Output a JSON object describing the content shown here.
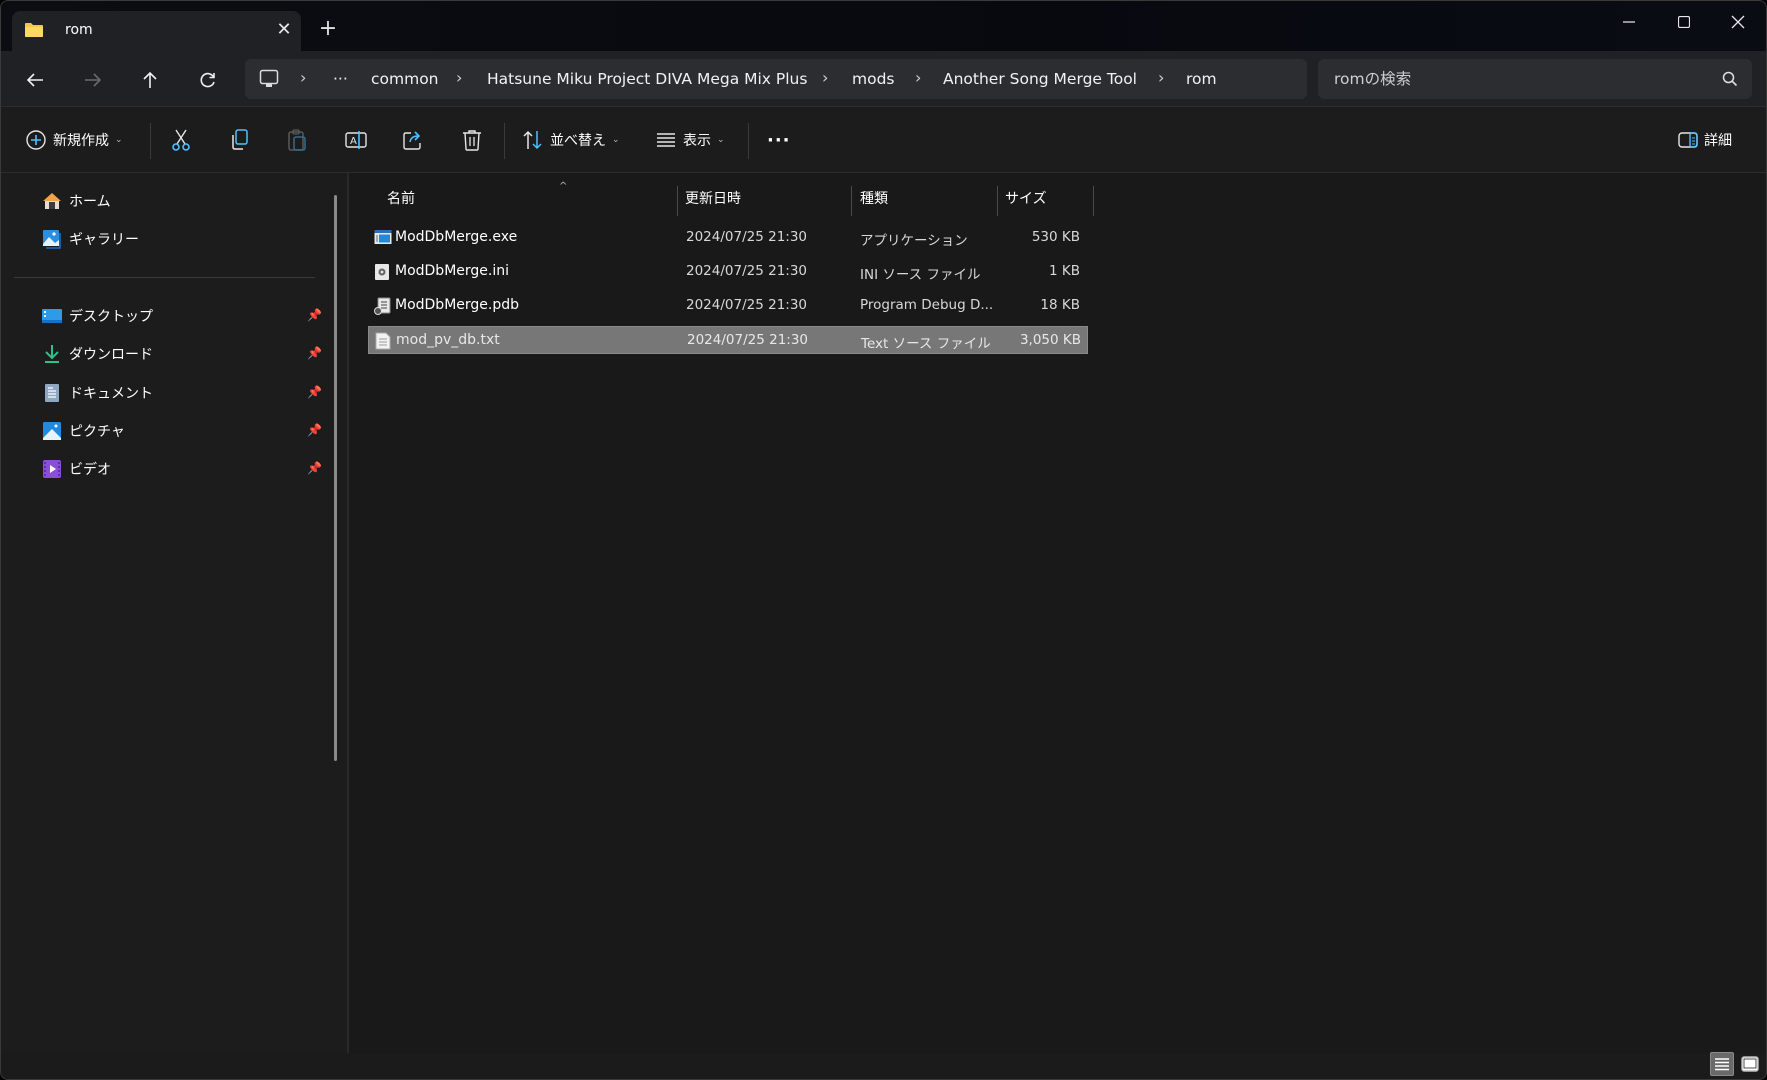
{
  "tab": {
    "title": "rom",
    "close_label": "✕",
    "new_tab_label": "+"
  },
  "window_controls": {
    "minimize": "—",
    "maximize": "☐",
    "close": "✕"
  },
  "breadcrumb": {
    "overflow": "···",
    "items": [
      "common",
      "Hatsune Miku Project DIVA Mega Mix Plus",
      "mods",
      "Another Song Merge Tool",
      "rom"
    ]
  },
  "search": {
    "placeholder": "romの検索",
    "value": ""
  },
  "toolbar": {
    "new_label": "新規作成",
    "sort_label": "並べ替え",
    "view_label": "表示",
    "more_label": "···",
    "details_label": "詳細"
  },
  "sidebar": {
    "top_items": [
      {
        "label": "ホーム",
        "icon": "home-icon"
      },
      {
        "label": "ギャラリー",
        "icon": "gallery-icon"
      }
    ],
    "pinned_items": [
      {
        "label": "デスクトップ",
        "icon": "desktop-icon",
        "pinned": true
      },
      {
        "label": "ダウンロード",
        "icon": "download-icon",
        "pinned": true
      },
      {
        "label": "ドキュメント",
        "icon": "documents-icon",
        "pinned": true
      },
      {
        "label": "ピクチャ",
        "icon": "pictures-icon",
        "pinned": true
      },
      {
        "label": "ビデオ",
        "icon": "videos-icon",
        "pinned": true
      }
    ]
  },
  "columns": {
    "name": "名前",
    "modified": "更新日時",
    "type": "種類",
    "size": "サイズ"
  },
  "files": [
    {
      "name": "ModDbMerge.exe",
      "modified": "2024/07/25 21:30",
      "type": "アプリケーション",
      "size": "530 KB",
      "icon": "exe-icon",
      "selected": false
    },
    {
      "name": "ModDbMerge.ini",
      "modified": "2024/07/25 21:30",
      "type": "INI ソース ファイル",
      "size": "1 KB",
      "icon": "ini-icon",
      "selected": false
    },
    {
      "name": "ModDbMerge.pdb",
      "modified": "2024/07/25 21:30",
      "type": "Program Debug D...",
      "size": "18 KB",
      "icon": "pdb-icon",
      "selected": false
    },
    {
      "name": "mod_pv_db.txt",
      "modified": "2024/07/25 21:30",
      "type": "Text ソース ファイル",
      "size": "3,050 KB",
      "icon": "txt-icon",
      "selected": true
    }
  ],
  "colors": {
    "accent": "#4cc2ff",
    "folder": "#f4c550",
    "selection": "#777777"
  }
}
